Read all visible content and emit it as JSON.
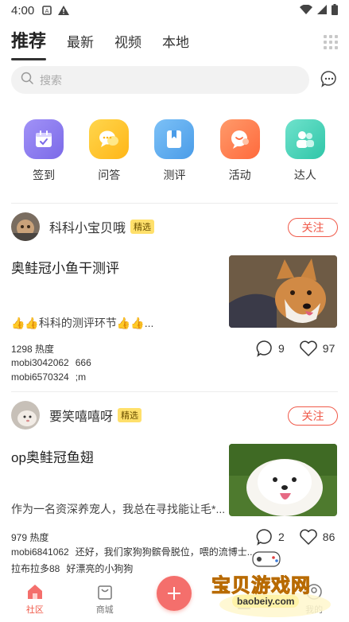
{
  "status_bar": {
    "time": "4:00"
  },
  "top_tabs": [
    {
      "label": "推荐",
      "active": true
    },
    {
      "label": "最新",
      "active": false
    },
    {
      "label": "视频",
      "active": false
    },
    {
      "label": "本地",
      "active": false
    }
  ],
  "search": {
    "placeholder": "搜索"
  },
  "categories": [
    {
      "label": "签到",
      "icon": "calendar-icon",
      "color": "#8a7cf0"
    },
    {
      "label": "问答",
      "icon": "chat-bubble-icon",
      "color": "#ffc62e"
    },
    {
      "label": "测评",
      "icon": "bookmark-icon",
      "color": "#5aaef0"
    },
    {
      "label": "活动",
      "icon": "megaphone-icon",
      "color": "#ff8150"
    },
    {
      "label": "达人",
      "icon": "users-icon",
      "color": "#3fd4b8"
    }
  ],
  "posts": [
    {
      "author": "科科小宝贝哦",
      "badge": "精选",
      "follow_label": "关注",
      "title": "奥鲑冠小鱼干测评",
      "excerpt": "👍👍科科的测评环节👍👍...",
      "heat": "1298 热度",
      "comments": "9",
      "likes": "97",
      "comment_lines": [
        {
          "user": "mobi3042062",
          "text": "666"
        },
        {
          "user": "mobi6570324",
          "text": ";m"
        }
      ]
    },
    {
      "author": "要笑嘻嘻呀",
      "badge": "精选",
      "follow_label": "关注",
      "title": "op奥鲑冠鱼翅",
      "excerpt": "作为一名资深养宠人，我总在寻找能让毛*...",
      "heat": "979 热度",
      "comments": "2",
      "likes": "86",
      "comment_lines": [
        {
          "user": "mobi6841062",
          "text": "还好，我们家狗狗髌骨脱位，喂的流博士..."
        },
        {
          "user": "拉布拉多88",
          "text": "好漂亮的小狗狗"
        }
      ]
    }
  ],
  "bottom_nav": [
    {
      "label": "社区",
      "icon": "home-icon",
      "active": true
    },
    {
      "label": "商城",
      "icon": "shopping-bag-icon",
      "active": false
    },
    {
      "label": "",
      "icon": "plus-icon",
      "active": false
    },
    {
      "label": "",
      "icon": "bell-icon",
      "active": false
    },
    {
      "label": "我的",
      "icon": "user-icon",
      "active": false
    }
  ],
  "watermark": {
    "title": "宝贝游戏网",
    "url": "baobeiy.com"
  },
  "colors": {
    "accent": "#f05a4a",
    "badge": "#ffe06b"
  }
}
